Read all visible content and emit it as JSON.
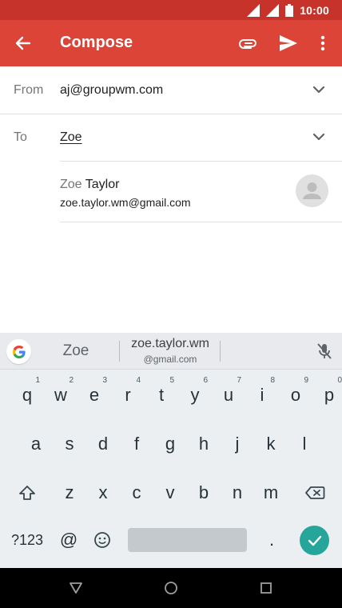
{
  "status_bar": {
    "time": "10:00"
  },
  "app_bar": {
    "title": "Compose"
  },
  "from": {
    "label": "From",
    "value": "aj@groupwm.com"
  },
  "to": {
    "label": "To",
    "value": "Zoe"
  },
  "suggestion": {
    "name_typed": "Zoe",
    "name_rest": " Taylor",
    "email": "zoe.taylor.wm@gmail.com"
  },
  "keyboard": {
    "suggestions": [
      {
        "main": "Zoe"
      },
      {
        "main": "zoe.taylor.wm",
        "sub": "@gmail.com"
      }
    ],
    "row1": [
      {
        "k": "q",
        "h": "1"
      },
      {
        "k": "w",
        "h": "2"
      },
      {
        "k": "e",
        "h": "3"
      },
      {
        "k": "r",
        "h": "4"
      },
      {
        "k": "t",
        "h": "5"
      },
      {
        "k": "y",
        "h": "6"
      },
      {
        "k": "u",
        "h": "7"
      },
      {
        "k": "i",
        "h": "8"
      },
      {
        "k": "o",
        "h": "9"
      },
      {
        "k": "p",
        "h": "0"
      }
    ],
    "row2": [
      "a",
      "s",
      "d",
      "f",
      "g",
      "h",
      "j",
      "k",
      "l"
    ],
    "row3": [
      "z",
      "x",
      "c",
      "v",
      "b",
      "n",
      "m"
    ],
    "symbols_label": "?123",
    "at_label": "@",
    "period_label": "."
  },
  "colors": {
    "app_bar": "#db4437",
    "status_bar": "#c5332a",
    "enter_key": "#26a69a"
  }
}
